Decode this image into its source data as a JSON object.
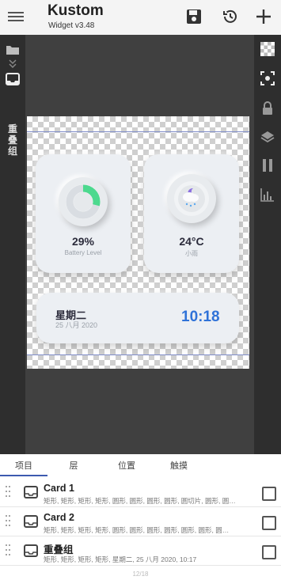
{
  "app": {
    "title": "Kustom",
    "subtitle": "Widget v3.48"
  },
  "toolbar": {
    "menu_icon": "hamburger-icon",
    "save_icon": "save-icon",
    "history_icon": "history-icon",
    "add_icon": "plus-icon"
  },
  "left_rail": {
    "label": "重叠组"
  },
  "widgets": {
    "battery": {
      "value": "29%",
      "label": "Battery Level",
      "percent": 29
    },
    "weather": {
      "temp": "24°C",
      "condition": "小雨"
    },
    "clock": {
      "weekday": "星期二",
      "date": "25 八月 2020",
      "time": "10:18"
    }
  },
  "tabs": [
    "项目",
    "层",
    "位置",
    "触摸"
  ],
  "items": [
    {
      "title": "Card 1",
      "sub": "矩形, 矩形, 矩形, 矩形, 圆形, 圆形, 圆形, 圆形, 圆切片, 圆形, 圆…"
    },
    {
      "title": "Card 2",
      "sub": "矩形, 矩形, 矩形, 矩形, 圆形, 圆形, 圆形, 圆形, 圆形, 圆形, 圆…"
    },
    {
      "title": "重叠组",
      "sub": "矩形, 矩形, 矩形, 矩形, 星期二, 25 八月 2020, 10:17"
    }
  ],
  "footer_hint": "12/18",
  "colors": {
    "accent": "#2f72d8",
    "battery_arc": "#4cd98e",
    "tab_underline": "#3d5ab0"
  }
}
